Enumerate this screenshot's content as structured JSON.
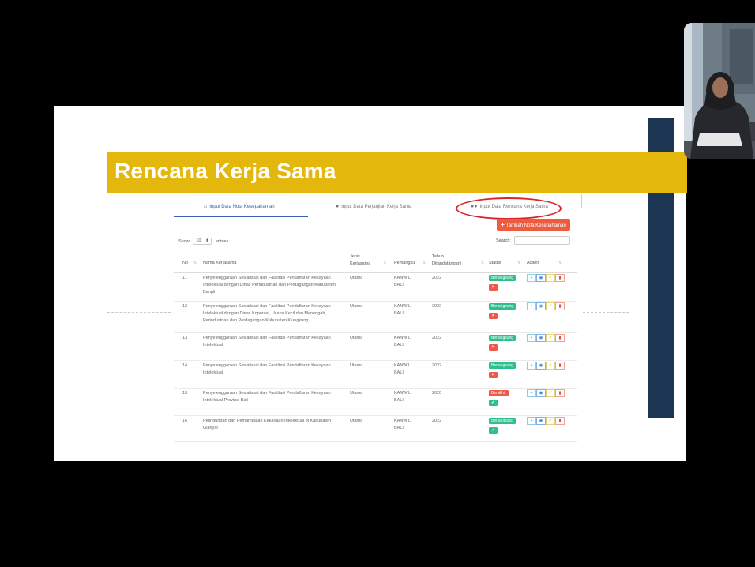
{
  "banner": {
    "title": "Rencana Kerja Sama"
  },
  "tabs": [
    {
      "label": "Input Data Nota Kesepahaman",
      "icon": "home-icon",
      "active": true
    },
    {
      "label": "Input Data Perjanjian Kerja Sama",
      "icon": "user-icon",
      "active": false
    },
    {
      "label": "Input Data Rencana Kerja Sama",
      "icon": "users-icon",
      "active": false
    }
  ],
  "toolbar": {
    "add_label": "Tambah Nota Kesepahaman",
    "add_icon": "+"
  },
  "show": {
    "prefix": "Show",
    "value": "10",
    "suffix": "entries"
  },
  "search": {
    "label": "Search:",
    "value": ""
  },
  "table": {
    "headers": {
      "no": "No",
      "nama": "Nama Kerjasama",
      "jenis": "Jenis Kerjasama",
      "pemangku": "Pemangku",
      "tahun": "Tahun Ditandatangani",
      "status": "Status",
      "action": "Action"
    },
    "rows": [
      {
        "no": "11",
        "nama": "Penyelenggaraan Sosialisasi dan Fasilitasi Pendaftaran Kekayaan Intelektual dengan Dinas Perindustrian dan Perdagangan Kabupaten Bangli",
        "jenis": "Utama",
        "pemangku": "KANWIL BALI",
        "tahun": "2022",
        "status": "Berlangsung",
        "status_color": "#2fbf8e",
        "mini": "×",
        "mini_color": "#ec5b4a"
      },
      {
        "no": "12",
        "nama": "Penyelenggaraan Sosialisasi dan Fasilitasi Pendaftaran Kekayaan Intelektual dengan Dinas Koperasi, Usaha Kecil dan Menengah, Perindustrian dan Perdagangan Kabupaten Klungkung",
        "jenis": "Utama",
        "pemangku": "KANWIL BALI",
        "tahun": "2022",
        "status": "Berlangsung",
        "status_color": "#2fbf8e",
        "mini": "×",
        "mini_color": "#ec5b4a"
      },
      {
        "no": "13",
        "nama": "Penyelenggaraan Sosialisasi dan Fasilitasi Pendaftaran Kekayaan Intelektual",
        "jenis": "Utama",
        "pemangku": "KANWIL BALI",
        "tahun": "2022",
        "status": "Berlangsung",
        "status_color": "#2fbf8e",
        "mini": "×",
        "mini_color": "#ec5b4a"
      },
      {
        "no": "14",
        "nama": "Penyelenggaraan Sosialisasi dan Fasilitasi Pendaftaran Kekayaan Intelektual",
        "jenis": "Utama",
        "pemangku": "KANWIL BALI",
        "tahun": "2022",
        "status": "Berlangsung",
        "status_color": "#2fbf8e",
        "mini": "×",
        "mini_color": "#ec5b4a"
      },
      {
        "no": "15",
        "nama": "Penyelenggaraan Sosialisasi dan Fasilitasi Pendaftaran Kekayaan Intelektual Provinsi Bali",
        "jenis": "Utama",
        "pemangku": "KANWIL BALI",
        "tahun": "2020",
        "status": "Berakhir",
        "status_color": "#ec5b4a",
        "mini": "✓",
        "mini_color": "#2fbf8e"
      },
      {
        "no": "16",
        "nama": "Pelindungan dan Pemanfaatan Kekayaan Intelektual di Kabupaten Gianyar",
        "jenis": "Utama",
        "pemangku": "KANWIL BALI",
        "tahun": "2022",
        "status": "Berlangsung",
        "status_color": "#2fbf8e",
        "mini": "✓",
        "mini_color": "#2fbf8e"
      }
    ],
    "action_icons": [
      "plus-icon",
      "eye-icon",
      "check-icon",
      "trash-icon"
    ]
  },
  "colors": {
    "banner": "#e3b70b",
    "navy": "#1c3553",
    "tab_active": "#3b5db8",
    "add_button": "#ef5b3f",
    "highlight_circle": "#d9262b"
  }
}
